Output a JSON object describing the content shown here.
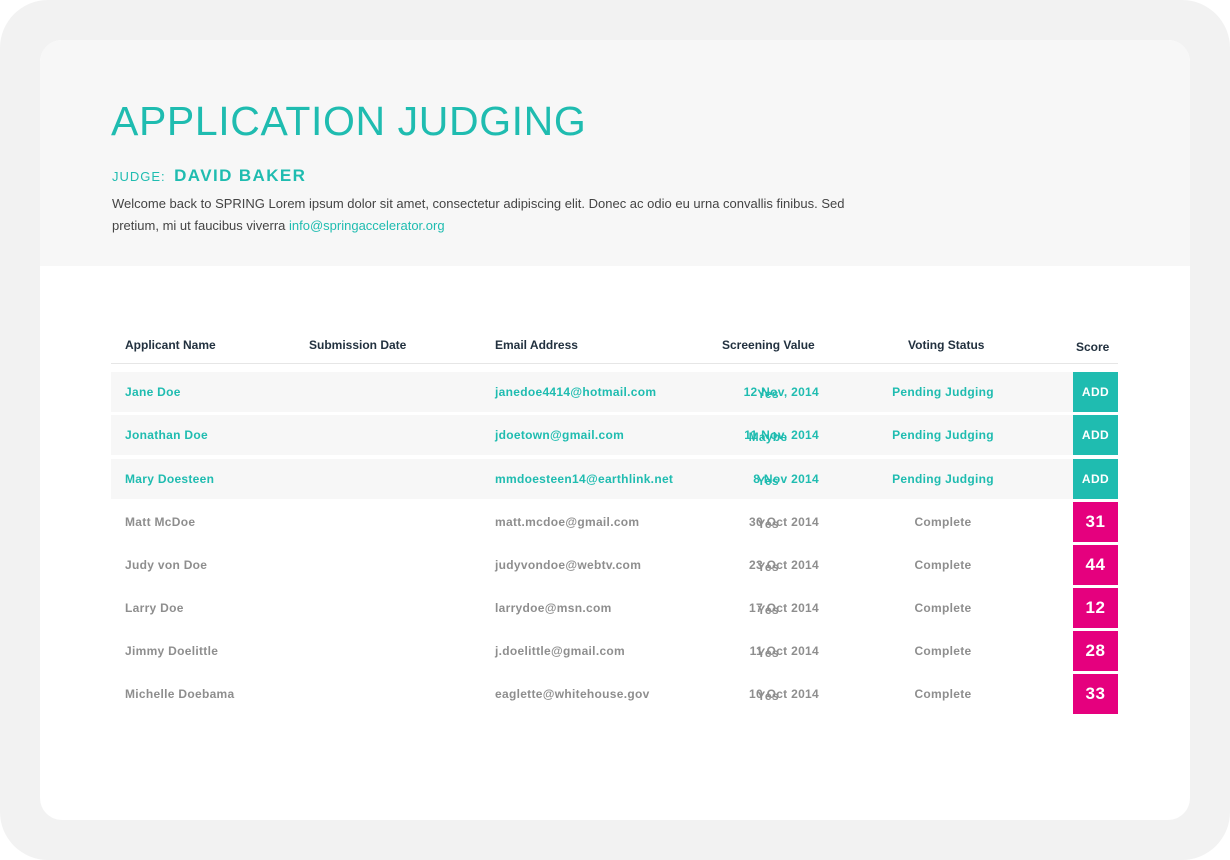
{
  "header": {
    "title": "APPLICATION JUDGING",
    "judge_label": "JUDGE:",
    "judge_name": "DAVID BAKER",
    "intro_text": "Welcome back to SPRING Lorem ipsum dolor sit amet, consectetur adipiscing elit. Donec ac odio eu urna convallis finibus. Sed pretium, mi ut faucibus viverra ",
    "intro_email": "info@springaccelerator.org"
  },
  "table": {
    "columns": {
      "name": "Applicant Name",
      "date": "Submission Date",
      "email": "Email Address",
      "screening": "Screening Value",
      "status": "Voting Status",
      "score": "Score"
    },
    "rows": [
      {
        "name": "Jane Doe",
        "date": "12 Nov, 2014",
        "email": "janedoe4414@hotmail.com",
        "screening": "Yes",
        "status": "Pending Judging",
        "score": "ADD",
        "state": "pending"
      },
      {
        "name": "Jonathan Doe",
        "date": "11 Nov, 2014",
        "email": "jdoetown@gmail.com",
        "screening": "Maybe",
        "status": "Pending Judging",
        "score": "ADD",
        "state": "pending"
      },
      {
        "name": "Mary Doesteen",
        "date": "8 Nov 2014",
        "email": "mmdoesteen14@earthlink.net",
        "screening": "Yes",
        "status": "Pending Judging",
        "score": "ADD",
        "state": "pending"
      },
      {
        "name": "Matt McDoe",
        "date": "30 Oct 2014",
        "email": "matt.mcdoe@gmail.com",
        "screening": "Yes",
        "status": "Complete",
        "score": "31",
        "state": "done"
      },
      {
        "name": "Judy von Doe",
        "date": "23 Oct 2014",
        "email": "judyvondoe@webtv.com",
        "screening": "Yes",
        "status": "Complete",
        "score": "44",
        "state": "done"
      },
      {
        "name": "Larry Doe",
        "date": "17 Oct 2014",
        "email": "larrydoe@msn.com",
        "screening": "Yes",
        "status": "Complete",
        "score": "12",
        "state": "done"
      },
      {
        "name": "Jimmy Doelittle",
        "date": "11 Oct 2014",
        "email": "j.doelittle@gmail.com",
        "screening": "Yes",
        "status": "Complete",
        "score": "28",
        "state": "done"
      },
      {
        "name": "Michelle Doebama",
        "date": "10 Oct 2014",
        "email": "eaglette@whitehouse.gov",
        "screening": "Yes",
        "status": "Complete",
        "score": "33",
        "state": "done"
      }
    ]
  },
  "colors": {
    "accent_teal": "#1fbcb0",
    "score_magenta": "#e5007e",
    "complete_gray": "#8e8e8e",
    "header_text": "#22313f"
  }
}
